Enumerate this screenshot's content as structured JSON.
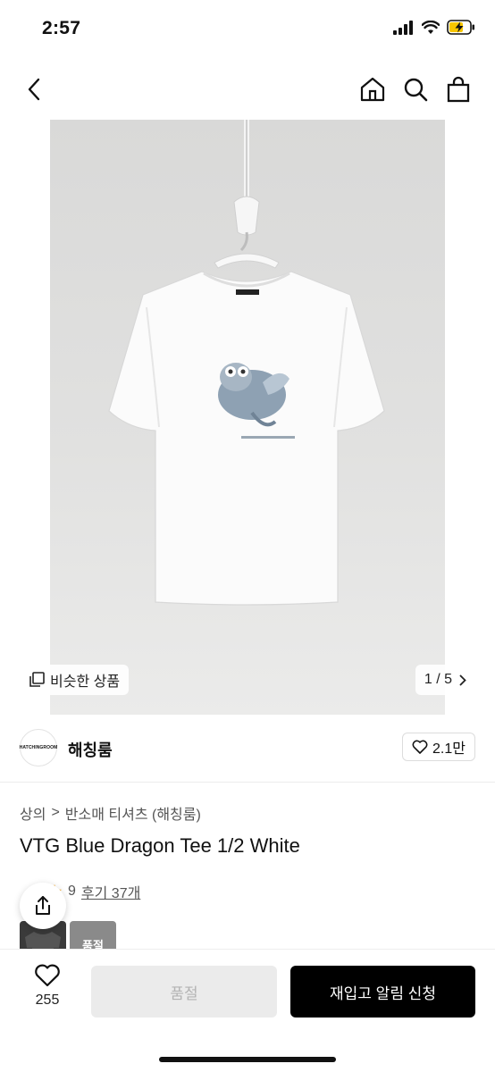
{
  "status_bar": {
    "time": "2:57",
    "icons": [
      "signal-icon",
      "wifi-icon",
      "battery-charging-icon"
    ]
  },
  "nav": {
    "icons": [
      "back-chevron-icon",
      "home-icon",
      "search-icon",
      "shopping-bag-icon"
    ]
  },
  "hero": {
    "similar_label": "비슷한 상품",
    "counter": "1 / 5",
    "counter_current": 1,
    "counter_total": 5
  },
  "brand": {
    "logo_text": "HATCHINGROOM",
    "name": "해칭룸",
    "like_count": "2.1만"
  },
  "breadcrumb": {
    "category": "상의",
    "separator": ">",
    "subcategory": "반소매 티셔츠 (해칭룸)"
  },
  "product": {
    "title": "VTG Blue Dragon Tee 1/2 White",
    "rating_partial": "9",
    "review_link": "후기 37개",
    "thumb_soldout_label": "품절"
  },
  "bottom": {
    "wish_count": "255",
    "soldout_label": "품절",
    "restock_label": "재입고 알림 신청"
  },
  "colors": {
    "accent_black": "#000000",
    "disabled_bg": "#ebebeb",
    "star_color": "#f5a623"
  }
}
